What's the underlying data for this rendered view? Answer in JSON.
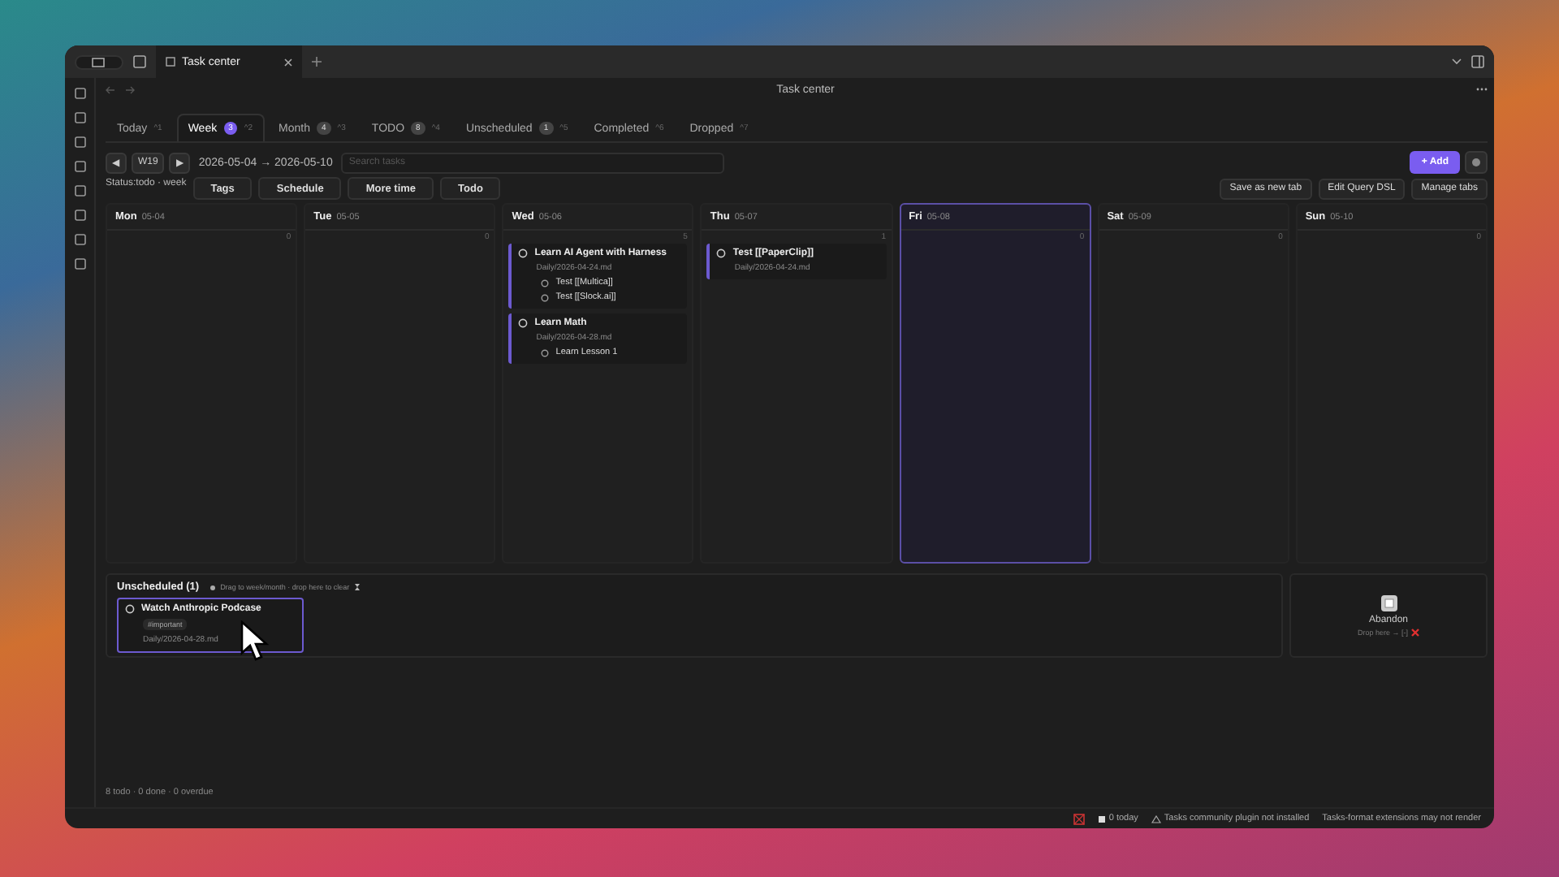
{
  "window_tabs": [
    {
      "label": "Task center",
      "selected": true
    }
  ],
  "title": "Task center",
  "view_tabs": [
    {
      "label": "Today",
      "shortcut": "^1",
      "selected": false
    },
    {
      "label": "Week",
      "count": "3",
      "shortcut": "^2",
      "selected": true
    },
    {
      "label": "Month",
      "count": "4",
      "shortcut": "^3",
      "selected": false
    },
    {
      "label": "TODO",
      "count": "8",
      "shortcut": "^4",
      "selected": false
    },
    {
      "label": "Unscheduled",
      "count": "1",
      "shortcut": "^5",
      "selected": false
    },
    {
      "label": "Completed",
      "shortcut": "^6",
      "selected": false
    },
    {
      "label": "Dropped",
      "shortcut": "^7",
      "selected": false
    }
  ],
  "week_nav": {
    "prev": "◀",
    "week": "W19",
    "next": "▶",
    "range": "2026-05-04 → 2026-05-10",
    "search_placeholder": "Search tasks"
  },
  "add_button": "+ Add",
  "filter_label": "Status:todo · week",
  "filter_buttons": [
    "Tags",
    "Schedule",
    "More time",
    "Todo"
  ],
  "actions": [
    "Save as new tab",
    "Edit Query DSL",
    "Manage tabs"
  ],
  "days": [
    {
      "day": "Mon",
      "date": "05-04",
      "count": "0",
      "selected": false
    },
    {
      "day": "Tue",
      "date": "05-05",
      "count": "0",
      "selected": false
    },
    {
      "day": "Wed",
      "date": "05-06",
      "count": "5",
      "selected": false,
      "tasks": [
        {
          "title": "Learn AI Agent with Harness",
          "path": "Daily/2026-04-24.md",
          "children": [
            {
              "title": "Test [[Multica]]"
            },
            {
              "title": "Test [[Slock.ai]]"
            }
          ]
        },
        {
          "title": "Learn Math",
          "path": "Daily/2026-04-28.md",
          "children": [
            {
              "title": "Learn Lesson 1"
            }
          ]
        }
      ]
    },
    {
      "day": "Thu",
      "date": "05-07",
      "count": "1",
      "selected": false,
      "tasks": [
        {
          "title": "Test [[PaperClip]]",
          "path": "Daily/2026-04-24.md"
        }
      ]
    },
    {
      "day": "Fri",
      "date": "05-08",
      "count": "0",
      "selected": true
    },
    {
      "day": "Sat",
      "date": "05-09",
      "count": "0",
      "selected": false
    },
    {
      "day": "Sun",
      "date": "05-10",
      "count": "0",
      "selected": false
    }
  ],
  "unscheduled": {
    "title": "Unscheduled (1)",
    "hint": "Drag to week/month · drop here to clear",
    "tasks": [
      {
        "title": "Watch Anthropic Podcase",
        "tag": "#important",
        "path": "Daily/2026-04-28.md",
        "selected": true
      }
    ]
  },
  "abandon": {
    "label": "Abandon",
    "hint": "Drop here → [-]"
  },
  "footer": "8 todo · 0 done · 0 overdue",
  "status_bar": [
    "0 today",
    "Tasks community plugin not installed",
    "Tasks-format extensions may not render"
  ]
}
